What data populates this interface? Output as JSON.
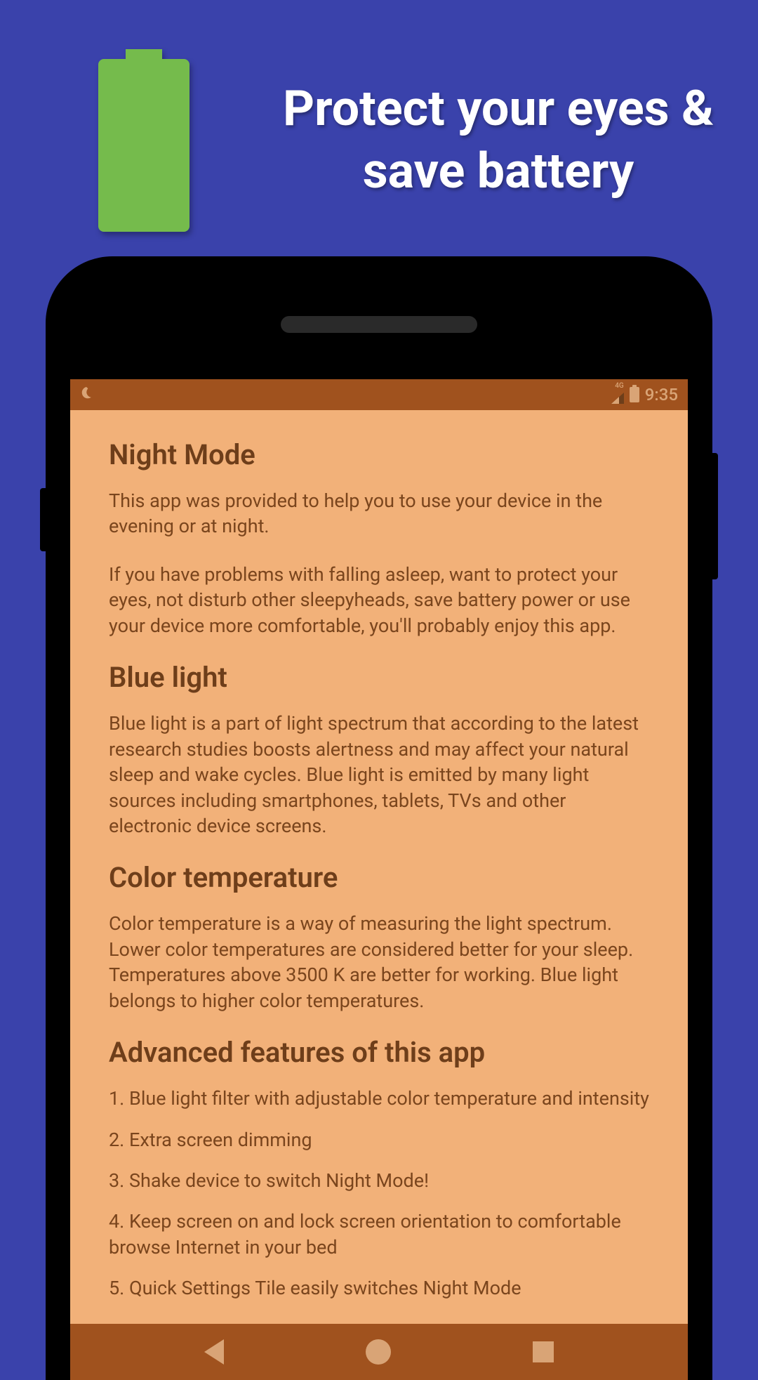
{
  "marketing": {
    "headline": "Protect your eyes & save battery"
  },
  "status": {
    "network": "4G",
    "time": "9:35"
  },
  "content": {
    "title1": "Night Mode",
    "para1": "This app was provided to help you to use your device in the evening or at night.",
    "para2": "If you have problems with falling asleep, want to protect your eyes, not disturb other sleepyheads, save battery power or use your device more comfortable, you'll probably enjoy this app.",
    "title2": "Blue light",
    "para3": "Blue light is a part of light spectrum that according to the latest research studies boosts alertness and may affect your natural sleep and wake cycles. Blue light is emitted by many light sources including smartphones, tablets, TVs and other electronic device screens.",
    "title3": "Color temperature",
    "para4": "Color temperature is a way of measuring the light spectrum. Lower color temperatures are considered better for your sleep. Temperatures above 3500 K are better for working. Blue light belongs to higher color temperatures.",
    "title4": "Advanced features of this app",
    "features": [
      "1. Blue light filter with adjustable color temperature and intensity",
      "2. Extra screen dimming",
      "3. Shake device to switch Night Mode!",
      "4. Keep screen on and lock screen orientation to comfortable browse Internet in your bed",
      "5. Quick Settings Tile easily switches Night Mode"
    ]
  }
}
